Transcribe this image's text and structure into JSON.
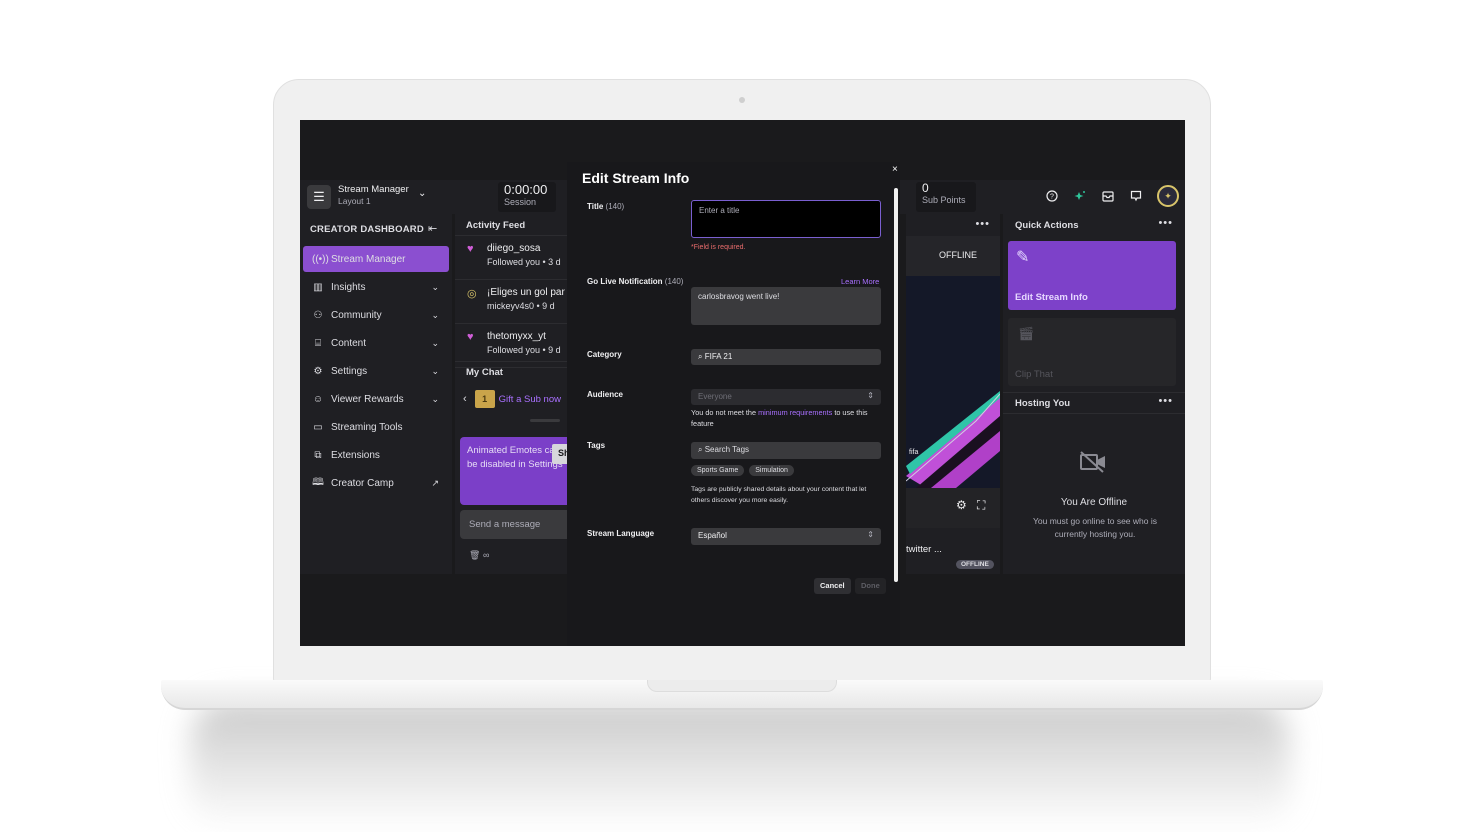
{
  "topbar": {
    "layout_title": "Stream Manager",
    "layout_subtitle": "Layout 1",
    "session_value": "0:00:00",
    "session_label": "Session",
    "sub_points_value": "0",
    "sub_points_label": "Sub Points",
    "icons": [
      "help-icon",
      "prime-sparkle-icon",
      "inbox-icon",
      "whispers-icon",
      "avatar"
    ]
  },
  "sidebar": {
    "heading": "CREATOR DASHBOARD",
    "items": [
      {
        "label": "Stream Manager",
        "icon": "broadcast-icon",
        "active": true,
        "expandable": false
      },
      {
        "label": "Insights",
        "icon": "insights-icon",
        "active": false,
        "expandable": true
      },
      {
        "label": "Community",
        "icon": "community-icon",
        "active": false,
        "expandable": true
      },
      {
        "label": "Content",
        "icon": "content-icon",
        "active": false,
        "expandable": true
      },
      {
        "label": "Settings",
        "icon": "settings-icon",
        "active": false,
        "expandable": true
      },
      {
        "label": "Viewer Rewards",
        "icon": "rewards-icon",
        "active": false,
        "expandable": true
      },
      {
        "label": "Streaming Tools",
        "icon": "camera-icon",
        "active": false,
        "expandable": false
      },
      {
        "label": "Extensions",
        "icon": "extensions-icon",
        "active": false,
        "expandable": false
      },
      {
        "label": "Creator Camp",
        "icon": "book-icon",
        "active": false,
        "external": true
      }
    ]
  },
  "activity_feed": {
    "title": "Activity Feed",
    "items": [
      {
        "name": "diiego_sosa",
        "detail": "Followed you • 3 d",
        "icon": "heart-icon",
        "color": "#d05ed8"
      },
      {
        "name": "¡Eliges un gol par",
        "detail": "mickeyv4s0 • 9 d",
        "icon": "points-icon",
        "color": "#d8c46a"
      },
      {
        "name": "thetomyxx_yt",
        "detail": "Followed you • 9 d",
        "icon": "heart-icon",
        "color": "#d05ed8"
      }
    ]
  },
  "chat": {
    "title": "My Chat",
    "gift_label": "Gift a Sub now",
    "gift_count": "1",
    "notice": "Animated Emotes can be disabled in Settings",
    "notice_button": "Sho",
    "message_placeholder": "Send a message",
    "tools_symbol": "∞"
  },
  "modal": {
    "title": "Edit Stream Info",
    "close": "×",
    "title_label": "Title",
    "title_limit": "(140)",
    "title_placeholder": "Enter a title",
    "title_error": "*Field is required.",
    "gln_label": "Go Live Notification",
    "gln_limit": "(140)",
    "learn_more": "Learn More",
    "gln_value": "carlosbravog went live!",
    "category_label": "Category",
    "category_value": "FIFA 21",
    "audience_label": "Audience",
    "audience_value": "Everyone",
    "audience_note_pre": "You do not meet the ",
    "audience_note_link": "minimum requirements",
    "audience_note_post": " to use this feature",
    "tags_label": "Tags",
    "tags_placeholder": "Search Tags",
    "tags": [
      "Sports Game",
      "Simulation"
    ],
    "tags_note": "Tags are publicly shared details about your content that let others discover you more easily.",
    "language_label": "Stream Language",
    "language_value": "Español",
    "cancel": "Cancel",
    "done": "Done"
  },
  "video": {
    "status": "OFFLINE",
    "art_text": "fifa",
    "title": "twitter ...",
    "badge": "OFFLINE"
  },
  "quick_actions": {
    "title": "Quick Actions",
    "edit_label": "Edit Stream Info",
    "clip_label": "Clip That"
  },
  "hosting": {
    "title": "Hosting You",
    "status_title": "You Are Offline",
    "status_text": "You must go online to see who is currently hosting you."
  },
  "colors": {
    "accent": "#8b4fd0",
    "error": "#eb6d6d",
    "link": "#a970ff",
    "background": "#1f1f23"
  }
}
